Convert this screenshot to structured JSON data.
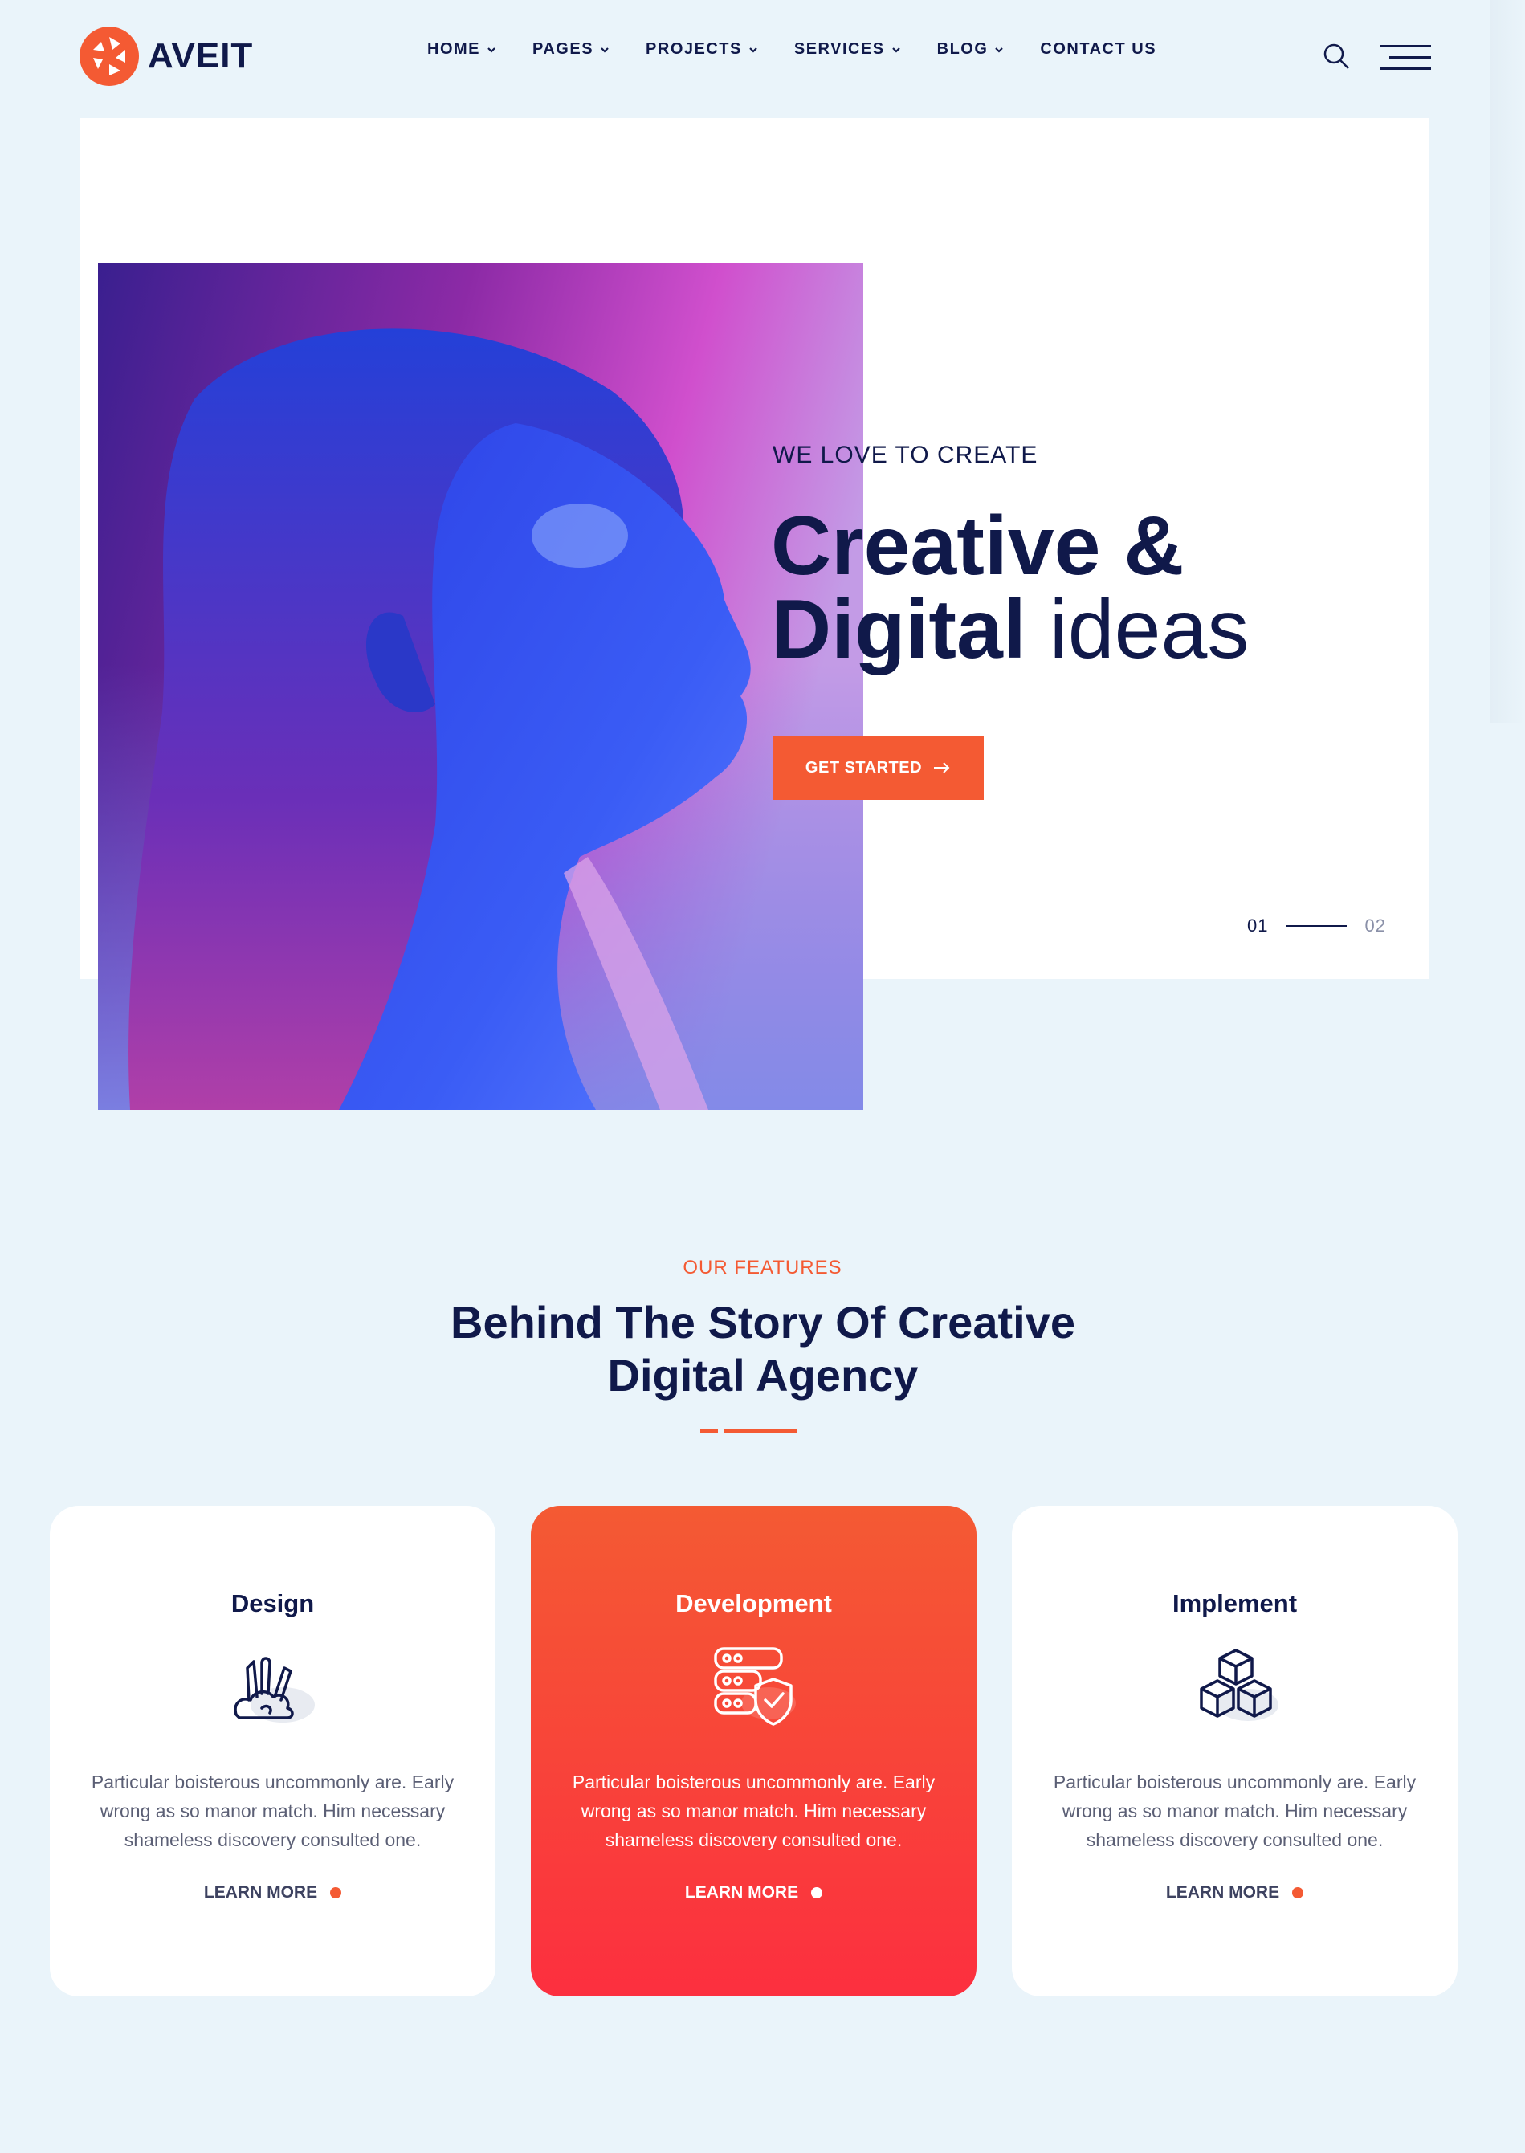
{
  "brand": {
    "name": "AVEIT",
    "accent": "#f45a33",
    "navy": "#10194a"
  },
  "nav": {
    "items": [
      {
        "label": "HOME",
        "has_dropdown": true
      },
      {
        "label": "PAGES",
        "has_dropdown": true
      },
      {
        "label": "PROJECTS",
        "has_dropdown": true
      },
      {
        "label": "SERVICES",
        "has_dropdown": true
      },
      {
        "label": "BLOG",
        "has_dropdown": true
      },
      {
        "label": "CONTACT US",
        "has_dropdown": false
      }
    ],
    "search_icon": "search-icon",
    "menu_icon": "hamburger-menu-icon"
  },
  "hero": {
    "eyebrow": "WE LOVE TO CREATE",
    "title_line1": "Creative &",
    "title_line2_bold": "Digital",
    "title_line2_light": "ideas",
    "cta_label": "GET STARTED",
    "cta_icon": "arrow-right-icon",
    "slide_current": "01",
    "slide_next": "02"
  },
  "features": {
    "eyebrow": "OUR FEATURES",
    "title_line1": "Behind The Story Of Creative",
    "title_line2": "Digital Agency",
    "cards": [
      {
        "title": "Design",
        "icon": "design-tools-icon",
        "text": "Particular boisterous uncommonly are. Early wrong as so manor match. Him necessary shameless discovery consulted one.",
        "link": "LEARN MORE",
        "active": false
      },
      {
        "title": "Development",
        "icon": "server-shield-icon",
        "text": "Particular boisterous uncommonly are. Early wrong as so manor match. Him necessary shameless discovery consulted one.",
        "link": "LEARN MORE",
        "active": true
      },
      {
        "title": "Implement",
        "icon": "cubes-icon",
        "text": "Particular boisterous uncommonly are. Early wrong as so manor match. Him necessary shameless discovery consulted one.",
        "link": "LEARN MORE",
        "active": false
      }
    ]
  }
}
